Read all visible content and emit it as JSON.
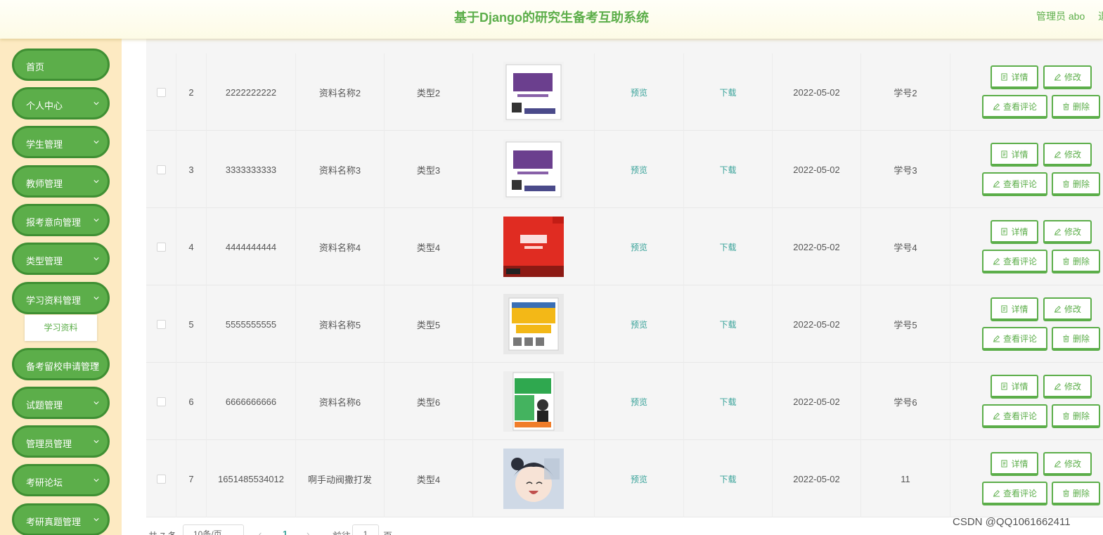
{
  "header": {
    "title": "基于Django的研究生备考互助系统",
    "user": "管理员 abo",
    "logout": "退"
  },
  "sidebar": {
    "items": [
      {
        "label": "首页",
        "has_children": false
      },
      {
        "label": "个人中心",
        "has_children": true
      },
      {
        "label": "学生管理",
        "has_children": true
      },
      {
        "label": "教师管理",
        "has_children": true
      },
      {
        "label": "报考意向管理",
        "has_children": true
      },
      {
        "label": "类型管理",
        "has_children": true
      },
      {
        "label": "学习资料管理",
        "has_children": true
      },
      {
        "label": "备考留校申请管理",
        "has_children": true
      },
      {
        "label": "试题管理",
        "has_children": true
      },
      {
        "label": "管理员管理",
        "has_children": true
      },
      {
        "label": "考研论坛",
        "has_children": true
      },
      {
        "label": "考研真题管理",
        "has_children": true
      }
    ],
    "active_sub": "学习资料"
  },
  "table": {
    "rows": [
      {
        "index": "2",
        "code": "2222222222",
        "name": "资料名称2",
        "type": "类型2",
        "preview": "预览",
        "download": "下载",
        "date": "2022-05-02",
        "student": "学号2",
        "cover": "purple-book"
      },
      {
        "index": "3",
        "code": "3333333333",
        "name": "资料名称3",
        "type": "类型3",
        "preview": "预览",
        "download": "下载",
        "date": "2022-05-02",
        "student": "学号3",
        "cover": "purple-book"
      },
      {
        "index": "4",
        "code": "4444444444",
        "name": "资料名称4",
        "type": "类型4",
        "preview": "预览",
        "download": "下载",
        "date": "2022-05-02",
        "student": "学号4",
        "cover": "red-book"
      },
      {
        "index": "5",
        "code": "5555555555",
        "name": "资料名称5",
        "type": "类型5",
        "preview": "预览",
        "download": "下载",
        "date": "2022-05-02",
        "student": "学号5",
        "cover": "orange-book"
      },
      {
        "index": "6",
        "code": "6666666666",
        "name": "资料名称6",
        "type": "类型6",
        "preview": "预览",
        "download": "下载",
        "date": "2022-05-02",
        "student": "学号6",
        "cover": "green-book"
      },
      {
        "index": "7",
        "code": "1651485534012",
        "name": "啊手动阀撒打发",
        "type": "类型4",
        "preview": "预览",
        "download": "下载",
        "date": "2022-05-02",
        "student": "11",
        "cover": "anime-portrait"
      }
    ],
    "actions": {
      "detail": "详情",
      "edit": "修改",
      "comments": "查看评论",
      "delete": "删除"
    }
  },
  "pagination": {
    "total": "共 7 条",
    "page_size": "10条/页",
    "current": "1",
    "goto": "前往",
    "page_input": "1",
    "unit": "页"
  },
  "watermark": "CSDN @QQ1061662411",
  "colors": {
    "accent": "#5cae4a",
    "sidebar_bg": "#fdeac2",
    "link": "#3aa39a"
  }
}
